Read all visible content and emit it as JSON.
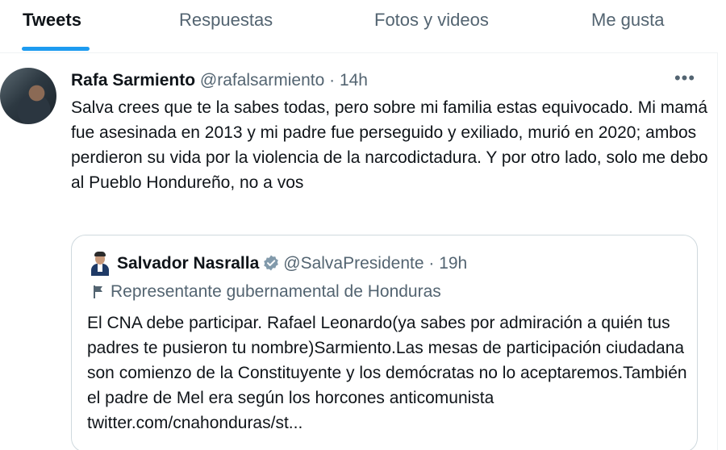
{
  "tabs": [
    {
      "label": "Tweets"
    },
    {
      "label": "Respuestas"
    },
    {
      "label": "Fotos y videos"
    },
    {
      "label": "Me gusta"
    }
  ],
  "tweet": {
    "author_name": "Rafa Sarmiento",
    "author_handle": "@rafalsarmiento",
    "separator": "·",
    "time": "14h",
    "text": "Salva crees que te la sabes todas, pero sobre mi familia estas equivocado. Mi mamá fue asesinada en 2013 y mi padre fue perseguido y exiliado, murió en 2020; ambos perdieron su vida por la violencia de la narcodictadura. Y por otro lado, solo me debo al Pueblo Hondureño, no a vos",
    "more_icon": "more-horizontal-icon"
  },
  "quote": {
    "author_name": "Salvador Nasralla",
    "author_handle": "@SalvaPresidente",
    "separator": "·",
    "time": "19h",
    "verified_icon": "verified-badge-icon",
    "label_icon": "flag-icon",
    "label": "Representante gubernamental de Honduras",
    "text": "El CNA debe participar. Rafael Leonardo(ya sabes por admiración a quién tus padres te pusieron tu nombre)Sarmiento.Las mesas de participación ciudadana son comienzo de la Constituyente y los demócratas no lo aceptaremos.También el padre de Mel era según los horcones anticomunista twitter.com/cnahonduras/st..."
  },
  "colors": {
    "accent": "#1d9bf0",
    "text": "#0f1419",
    "muted": "#536471",
    "border": "#cfd9de",
    "verified_badge": "#829aab"
  }
}
